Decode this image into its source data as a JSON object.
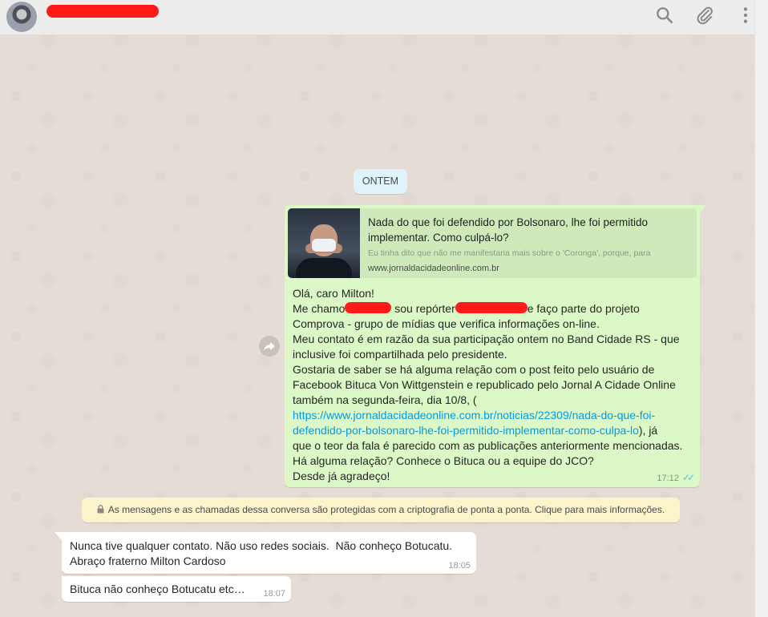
{
  "header": {
    "icons": [
      "search-icon",
      "attach-icon",
      "menu-icon"
    ]
  },
  "date_divider": "ONTEM",
  "outgoing": {
    "preview": {
      "title": "Nada do que foi defendido por Bolsonaro, lhe foi permitido implementar. Como culpá-lo?",
      "description": "Eu tinha dito que não me manifestaria mais sobre o 'Coronga', porque, para",
      "domain": "www.jornaldacidadeonline.com.br"
    },
    "lines": {
      "l1": "Olá, caro Milton!",
      "l2a": "Me chamo",
      "l2b": " sou repórter",
      "l2c": "e faço parte do projeto",
      "l3": "Comprova - grupo de mídias que verifica informações on-line.",
      "l4": "Meu contato é em razão da sua participação ontem no Band Cidade RS - que",
      "l5": "inclusive foi compartilhada pelo presidente.",
      "l6": "Gostaria de saber se há alguma relação com o post feito pelo usuário de",
      "l7": "Facebook Bituca Von Wittgenstein e republicado pelo Jornal A Cidade Online",
      "l8": "também na segunda-feira, dia 10/8, (",
      "link_a": "https://www.jornaldacidadeonline.com.br/noticias/22309/nada-do-que-foi-",
      "link_b": "defendido-por-bolsonaro-lhe-foi-permitido-implementar-como-culpa-lo",
      "l9b": "), já",
      "l10": "que o teor da fala é parecido com as publicações anteriormente mencionadas.",
      "l11": "Há alguma relação? Conhece o Bituca ou a equipe do JCO?",
      "l12": "Desde já agradeço!"
    },
    "time": "17:12"
  },
  "encryption_notice": "As mensagens e as chamadas dessa conversa são protegidas com a criptografia de ponta a ponta. Clique para mais informações.",
  "incoming": [
    {
      "text": "Nunca tive qualquer contato. Não uso redes sociais.  Não conheço Botucatu.\nAbraço fraterno Milton Cardoso",
      "time": "18:05"
    },
    {
      "text": "Bituca não conheço Botucatu etc…",
      "time": "18:07"
    }
  ],
  "colors": {
    "outgoing_bubble": "#dcf8c6",
    "incoming_bubble": "#ffffff",
    "notice_bg": "#fcf4cb",
    "date_chip_bg": "#e1f3fb",
    "link": "#039be5",
    "read_ticks": "#4fc3f7",
    "redaction": "#ff1a1a"
  }
}
